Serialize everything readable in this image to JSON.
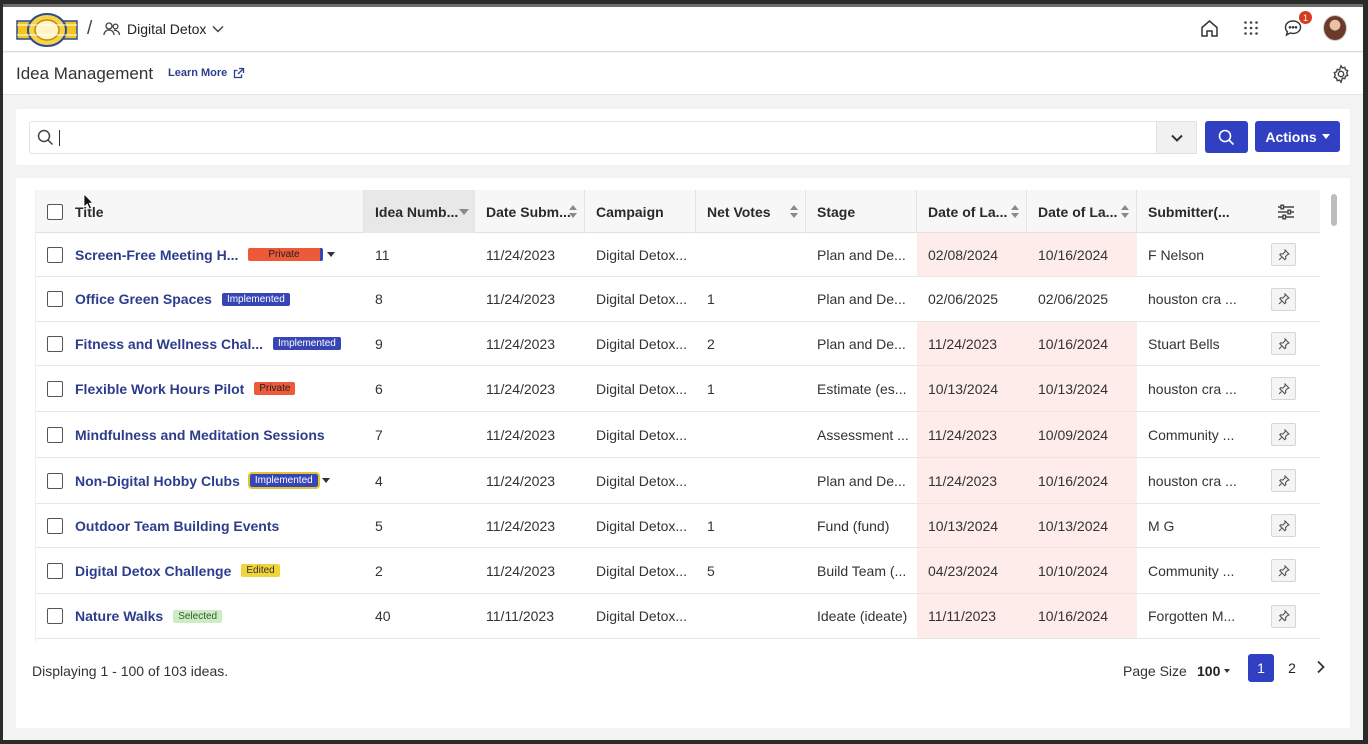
{
  "nav": {
    "workspace_label": "Digital Detox",
    "separator": "/",
    "notification_count": "1",
    "icons": [
      "home-icon",
      "apps-grid-icon",
      "chat-icon",
      "user-avatar"
    ]
  },
  "header": {
    "title": "Idea Management",
    "learn_more": "Learn More"
  },
  "search": {
    "value": "",
    "actions_label": "Actions"
  },
  "grid": {
    "columns": [
      {
        "label": "Title"
      },
      {
        "label": "Idea Numb..."
      },
      {
        "label": "Date Subm..."
      },
      {
        "label": "Campaign"
      },
      {
        "label": "Net Votes"
      },
      {
        "label": "Stage"
      },
      {
        "label": "Date of La..."
      },
      {
        "label": "Date of La..."
      },
      {
        "label": "Submitter(..."
      }
    ],
    "rows": [
      {
        "title": "Screen-Free Meeting H...",
        "tag": "Private",
        "idea_number": "11",
        "date_submitted": "11/24/2023",
        "campaign": "Digital Detox...",
        "net_votes": "",
        "stage": "Plan and De...",
        "date_last_1": "02/08/2024",
        "date_last_2": "10/16/2024",
        "submitter": "F Nelson"
      },
      {
        "title": "Office Green Spaces",
        "tag": "Implemented",
        "idea_number": "8",
        "date_submitted": "11/24/2023",
        "campaign": "Digital Detox...",
        "net_votes": "1",
        "stage": "Plan and De...",
        "date_last_1": "02/06/2025",
        "date_last_2": "02/06/2025",
        "submitter": "houston cra ..."
      },
      {
        "title": "Fitness and Wellness Chal...",
        "tag": "Implemented",
        "idea_number": "9",
        "date_submitted": "11/24/2023",
        "campaign": "Digital Detox...",
        "net_votes": "2",
        "stage": "Plan and De...",
        "date_last_1": "11/24/2023",
        "date_last_2": "10/16/2024",
        "submitter": "Stuart Bells"
      },
      {
        "title": "Flexible Work Hours Pilot",
        "tag": "Private",
        "idea_number": "6",
        "date_submitted": "11/24/2023",
        "campaign": "Digital Detox...",
        "net_votes": "1",
        "stage": "Estimate (es...",
        "date_last_1": "10/13/2024",
        "date_last_2": "10/13/2024",
        "submitter": "houston cra ..."
      },
      {
        "title": "Mindfulness and Meditation Sessions",
        "tag": "",
        "idea_number": "7",
        "date_submitted": "11/24/2023",
        "campaign": "Digital Detox...",
        "net_votes": "",
        "stage": "Assessment ...",
        "date_last_1": "11/24/2023",
        "date_last_2": "10/09/2024",
        "submitter": "Community  ..."
      },
      {
        "title": "Non-Digital Hobby Clubs",
        "tag": "Implemented",
        "idea_number": "4",
        "date_submitted": "11/24/2023",
        "campaign": "Digital Detox...",
        "net_votes": "",
        "stage": "Plan and De...",
        "date_last_1": "11/24/2023",
        "date_last_2": "10/16/2024",
        "submitter": "houston cra ..."
      },
      {
        "title": "Outdoor Team Building Events",
        "tag": "",
        "idea_number": "5",
        "date_submitted": "11/24/2023",
        "campaign": "Digital Detox...",
        "net_votes": "1",
        "stage": "Fund (fund)",
        "date_last_1": "10/13/2024",
        "date_last_2": "10/13/2024",
        "submitter": "M G"
      },
      {
        "title": "Digital Detox Challenge",
        "tag": "Edited",
        "idea_number": "2",
        "date_submitted": "11/24/2023",
        "campaign": "Digital Detox...",
        "net_votes": "5",
        "stage": "Build Team (...",
        "date_last_1": "04/23/2024",
        "date_last_2": "10/10/2024",
        "submitter": "Community  ..."
      },
      {
        "title": "Nature Walks",
        "tag": "Selected",
        "idea_number": "40",
        "date_submitted": "11/11/2023",
        "campaign": "Digital Detox...",
        "net_votes": "",
        "stage": "Ideate (ideate)",
        "date_last_1": "11/11/2023",
        "date_last_2": "10/16/2024",
        "submitter": "Forgotten M..."
      }
    ]
  },
  "footer": {
    "display_text": "Displaying 1 - 100 of 103 ideas.",
    "page_size_label": "Page Size",
    "page_size_value": "100",
    "pages": [
      "1",
      "2"
    ],
    "current_page": "1"
  },
  "colors": {
    "primary": "#3140c3",
    "link": "#2d3d8c",
    "private_tag": "#ec5a3a",
    "implemented_tag": "#3745b5",
    "edited_tag": "#f1d33a",
    "selected_tag": "#cdecc6",
    "highlight_cell": "#fdecea"
  }
}
